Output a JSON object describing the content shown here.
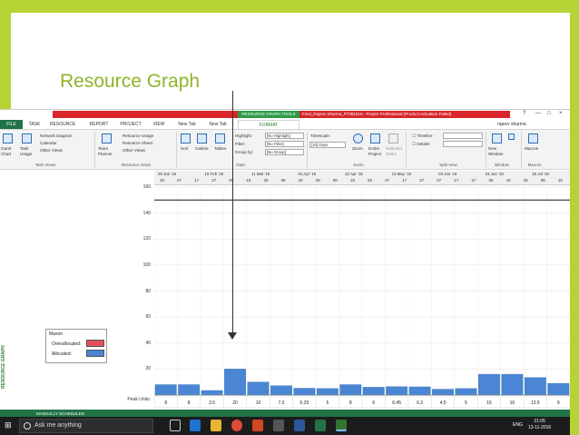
{
  "slide": {
    "title": "Resource Graph"
  },
  "window": {
    "context_tab": "RESOURCE GRAPH TOOLS",
    "title": "Final_Rajeev Sharma_PT381516 - Project Professional (Product Activation Failed)",
    "controls": [
      "?",
      "—",
      "□",
      "×"
    ]
  },
  "tabs": [
    "FILE",
    "TASK",
    "RESOURCE",
    "REPORT",
    "PROJECT",
    "VIEW",
    "New Tab",
    "New Tab",
    "FORMAT"
  ],
  "user": "rajeev sharma",
  "ribbon": {
    "gantt": "Gantt\nChart",
    "task_usage": "Task\nUsage",
    "network_diagram": "Network Diagram",
    "calendar": "Calendar",
    "other_views": "Other Views",
    "task_views_label": "Task Views",
    "team_planner": "Team\nPlanner",
    "resource_usage": "Resource Usage",
    "resource_sheet": "Resource Sheet",
    "other_views2": "Other Views",
    "resource_views_label": "Resource Views",
    "sort": "Sort",
    "outline": "Outline",
    "tables": "Tables",
    "highlight": "Highlight:",
    "highlight_val": "[No Highlight]",
    "filter": "Filter:",
    "filter_val": "[No Filter]",
    "group_by": "Group by:",
    "group_val": "[No Group]",
    "data_label": "Data",
    "timescale": "Timescale:",
    "timescale_val": "[10] Days",
    "zoom": "Zoom",
    "entire_project": "Entire\nProject",
    "selected_tasks": "Selected\nTasks",
    "zoom_label": "Zoom",
    "timeline": "Timeline",
    "details": "Details",
    "split_view_label": "Split View",
    "new_window": "New\nWindow",
    "window_label": "Window",
    "macros": "Macros",
    "macros_label": "Macros"
  },
  "timescale": {
    "top": [
      "28 Jan '19",
      "18 Feb '19",
      "11 Mar '19",
      "01 Apr '19",
      "22 Apr '19",
      "13 May '19",
      "03 Jun '19",
      "24 Jun '19",
      "15 Jul '19"
    ],
    "bottom": [
      "26",
      "07",
      "17",
      "27",
      "09",
      "19",
      "29",
      "08",
      "18",
      "28",
      "08",
      "18",
      "28",
      "07",
      "17",
      "27",
      "07",
      "17",
      "27",
      "06",
      "16",
      "26",
      "06",
      "16"
    ]
  },
  "side_label": "RESOURCE GRAPH",
  "legend": {
    "name": "Mason",
    "overallocated": "Overallocated:",
    "allocated": "Allocated:"
  },
  "colors": {
    "overallocated": "#e0505a",
    "allocated": "#4a86d4",
    "accent": "#217346",
    "slide_green": "#b5d334"
  },
  "chart_data": {
    "type": "bar",
    "ylim": [
      0,
      160
    ],
    "yticks": [
      "160",
      "140",
      "120",
      "100",
      "80",
      "60",
      "40",
      "20"
    ],
    "peak_label": "Peak Units:",
    "values": [
      8,
      8,
      3.5,
      20,
      10,
      7.2,
      5.25,
      5,
      8,
      6,
      6.45,
      6.3,
      4.5,
      5,
      16,
      16,
      13.5,
      9
    ],
    "peak_labels": [
      "8",
      "8",
      "3.5",
      "20",
      "10",
      "7.2",
      "5.25",
      "5",
      "8",
      "6",
      "6.45",
      "6.3",
      "4.5",
      "5",
      "16",
      "16",
      "13.5",
      "9"
    ],
    "max_line": 150
  },
  "statusbar": "MANUALLY SCHEDULED",
  "taskbar": {
    "search": "Ask me anything",
    "time": "21:05",
    "date": "13-11-2016",
    "lang": "ENG"
  }
}
